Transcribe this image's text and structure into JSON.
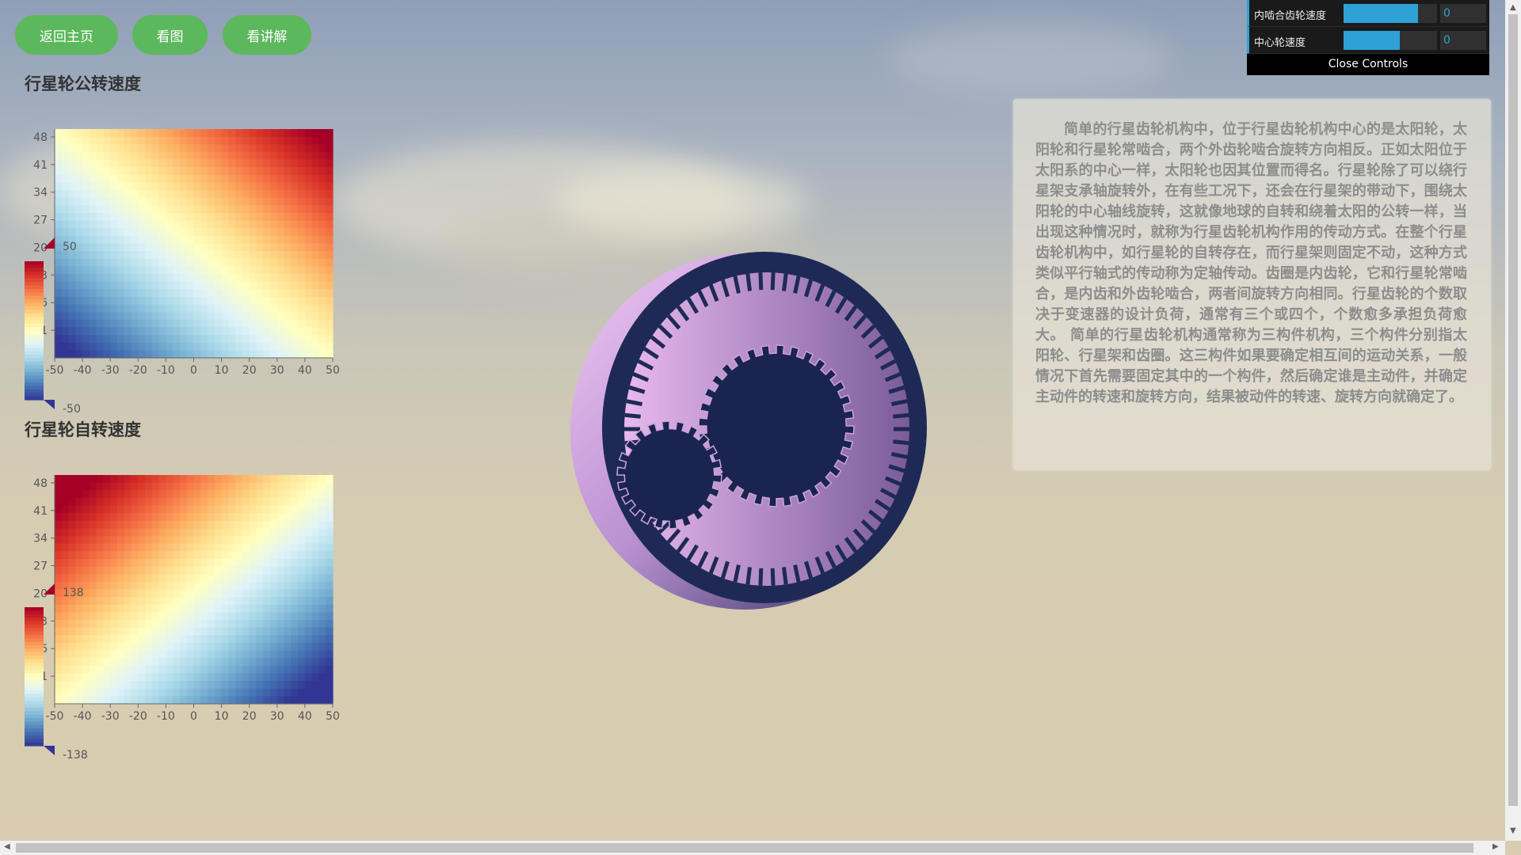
{
  "nav": {
    "home_label": "返回主页",
    "picture_label": "看图",
    "explain_label": "看讲解"
  },
  "controls": {
    "rows": [
      {
        "label": "内啮合齿轮速度",
        "value": "0",
        "fill_fraction": 0.8
      },
      {
        "label": "中心轮速度",
        "value": "0",
        "fill_fraction": 0.6
      }
    ],
    "close_label": "Close Controls",
    "accent_color": "#2fa1d6"
  },
  "info": {
    "text": "简单的行星齿轮机构中，位于行星齿轮机构中心的是太阳轮，太阳轮和行星轮常啮合，两个外齿轮啮合旋转方向相反。正如太阳位于太阳系的中心一样，太阳轮也因其位置而得名。行星轮除了可以绕行星架支承轴旋转外，在有些工况下，还会在行星架的带动下，围绕太阳轮的中心轴线旋转，这就像地球的自转和绕着太阳的公转一样，当出现这种情况时，就称为行星齿轮机构作用的传动方式。在整个行星齿轮机构中，如行星轮的自转存在，而行星架则固定不动，这种方式类似平行轴式的传动称为定轴传动。齿圈是内齿轮，它和行星轮常啮合，是内齿和外齿轮啮合，两者间旋转方向相同。行星齿轮的个数取决于变速器的设计负荷，通常有三个或四个，个数愈多承担负荷愈大。 简单的行星齿轮机构通常称为三构件机构，三个构件分别指太阳轮、行星架和齿圈。这三构件如果要确定相互间的运动关系，一般情况下首先需要固定其中的一个构件，然后确定谁是主动件，并确定主动件的转速和旋转方向，结果被动件的转速、旋转方向就确定了。"
  },
  "charts": {
    "revolution_title": "行星轮公转速度",
    "rotation_title": "行星轮自转速度"
  },
  "chart_data": [
    {
      "type": "heatmap",
      "title": "行星轮公转速度",
      "x_ticks": [
        -50,
        -40,
        -30,
        -20,
        -10,
        0,
        10,
        20,
        30,
        40,
        50
      ],
      "y_ticks": [
        48,
        41,
        34,
        27,
        20,
        13,
        6,
        -1
      ],
      "xlim": [
        -50,
        50
      ],
      "ylim": [
        -8,
        50
      ],
      "visual_map": {
        "max": 50,
        "min": -50,
        "max_label": "50",
        "min_label": "-50"
      },
      "value_direction": "increases toward top-right",
      "colors": [
        "#313695",
        "#4575b4",
        "#74add1",
        "#abd9e9",
        "#e0f3f8",
        "#ffffbf",
        "#fee090",
        "#fdae61",
        "#f46d43",
        "#d73027",
        "#a50026"
      ]
    },
    {
      "type": "heatmap",
      "title": "行星轮自转速度",
      "x_ticks": [
        -50,
        -40,
        -30,
        -20,
        -10,
        0,
        10,
        20,
        30,
        40,
        50
      ],
      "y_ticks": [
        48,
        41,
        34,
        27,
        20,
        13,
        6,
        -1
      ],
      "xlim": [
        -50,
        50
      ],
      "ylim": [
        -8,
        50
      ],
      "visual_map": {
        "max": 138,
        "min": -138,
        "max_label": "138",
        "min_label": "-138"
      },
      "value_direction": "increases toward top-left",
      "colors": [
        "#313695",
        "#4575b4",
        "#74add1",
        "#abd9e9",
        "#e0f3f8",
        "#ffffbf",
        "#fee090",
        "#fdae61",
        "#f46d43",
        "#d73027",
        "#a50026"
      ]
    }
  ]
}
